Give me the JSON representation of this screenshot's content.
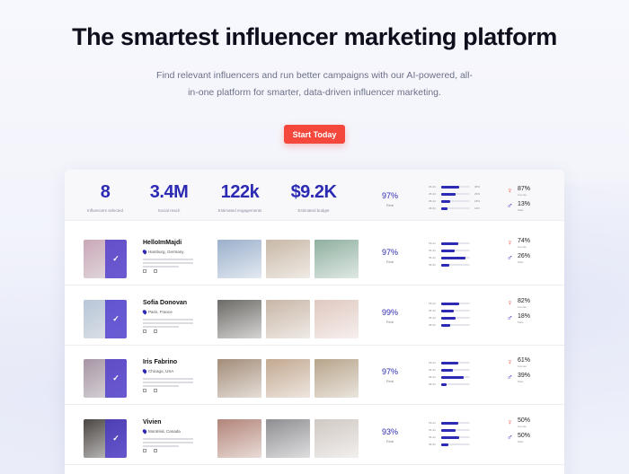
{
  "hero": {
    "title": "The smartest influencer marketing platform",
    "subtitle": "Find relevant influencers and run better campaigns with our AI-powered, all-in-one platform for smarter, data-driven influencer marketing.",
    "cta_label": "Start Today"
  },
  "summary": {
    "stats": [
      {
        "value": "8",
        "label": "Influencers selected"
      },
      {
        "value": "3.4M",
        "label": "Social reach"
      },
      {
        "value": "122k",
        "label": "Estimated engagements"
      },
      {
        "value": "$9.2K",
        "label": "Estimated budget"
      }
    ],
    "real_pct": "97%",
    "real_label": "Real",
    "audience": [
      {
        "label": "18-24",
        "pct": "38%",
        "level": 0.62
      },
      {
        "label": "25-34",
        "pct": "29%",
        "level": 0.5
      },
      {
        "label": "35-44",
        "pct": "18%",
        "level": 0.3
      },
      {
        "label": "45-54",
        "pct": "11%",
        "level": 0.22
      }
    ],
    "female_pct": "87%",
    "female_label": "Female",
    "male_pct": "13%",
    "male_label": "Male"
  },
  "influencers": [
    {
      "name": "HelloImMajdi",
      "location": "Hamburg, Germany",
      "real_pct": "97%",
      "audience": [
        0.6,
        0.48,
        0.84,
        0.28
      ],
      "female_pct": "74%",
      "male_pct": "26%",
      "colors": {
        "avatar": "#c9a7b7",
        "p1": "#9bb0cc",
        "p2": "#c8b8a6",
        "p3": "#8fb0a0"
      }
    },
    {
      "name": "Sofia Donovan",
      "location": "Paris, France",
      "real_pct": "99%",
      "audience": [
        0.62,
        0.44,
        0.5,
        0.32
      ],
      "female_pct": "82%",
      "male_pct": "18%",
      "colors": {
        "avatar": "#b7c6d8",
        "p1": "#6c6a66",
        "p2": "#c8b6a7",
        "p3": "#e0c8c0"
      }
    },
    {
      "name": "Iris Fabrino",
      "location": "Chicago, USA",
      "real_pct": "97%",
      "audience": [
        0.6,
        0.4,
        0.78,
        0.2
      ],
      "female_pct": "61%",
      "male_pct": "39%",
      "colors": {
        "avatar": "#a695a4",
        "p1": "#a38c78",
        "p2": "#c2a890",
        "p3": "#b7a48a"
      }
    },
    {
      "name": "Vivien",
      "location": "Montréal, Canada",
      "real_pct": "93%",
      "audience": [
        0.58,
        0.5,
        0.62,
        0.26
      ],
      "female_pct": "50%",
      "male_pct": "50%",
      "colors": {
        "avatar": "#4a4542",
        "p1": "#b28478",
        "p2": "#8e8e92",
        "p3": "#d0c8c2"
      }
    }
  ],
  "labels": {
    "real": "Real",
    "female": "Female",
    "male": "Male"
  }
}
